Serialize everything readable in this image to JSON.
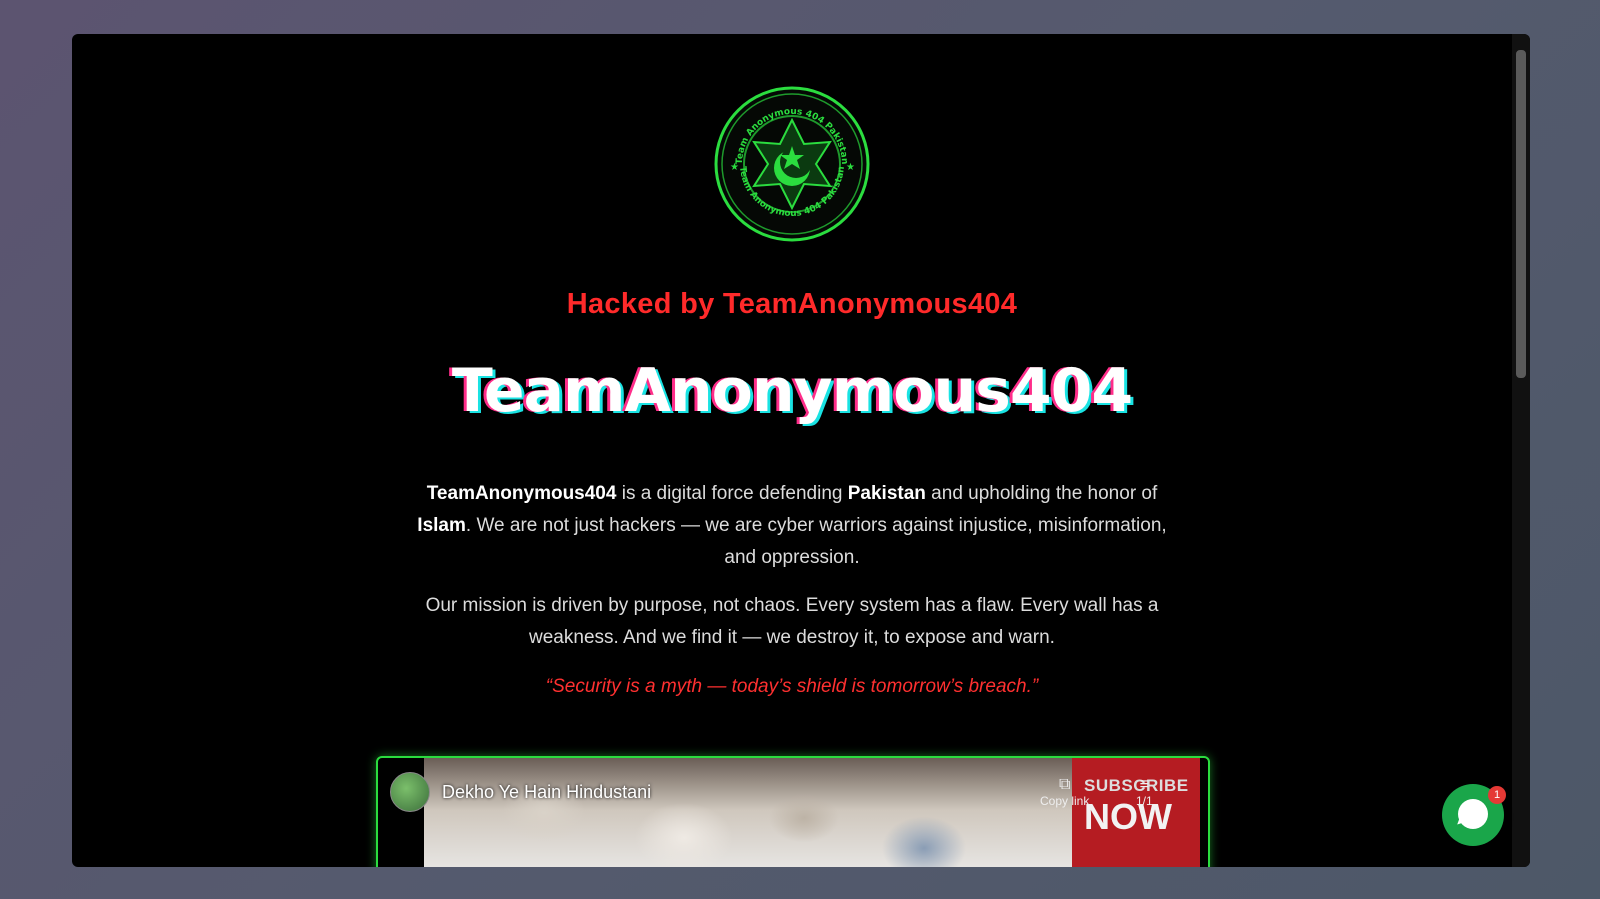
{
  "logo": {
    "ring_text": "Team Anonymous 404 Pakistan",
    "accent_color": "#2bdd3f"
  },
  "hero": {
    "subtitle": "Hacked by TeamAnonymous404",
    "title": "TeamAnonymous404"
  },
  "paragraph1": {
    "part1_bold": "TeamAnonymous404",
    "part2": " is a digital force defending ",
    "part3_bold": "Pakistan",
    "part4": " and upholding the honor of ",
    "part5_bold": "Islam",
    "part6": ". We are not just hackers — we are cyber warriors against injustice, misinformation, and oppression."
  },
  "paragraph2": "Our mission is driven by purpose, not chaos. Every system has a flaw. Every wall has a weakness. And we find it — we destroy it, to expose and warn.",
  "quote": "“Security is a myth — today’s shield is tomorrow’s breach.”",
  "video": {
    "title": "Dekho Ye Hain Hindustani",
    "subscribe_line1": "SUBSCRIBE",
    "subscribe_line2": "NOW",
    "copy_link_label": "Copy link",
    "playlist_count": "1/1"
  },
  "chat": {
    "badge_count": "1"
  },
  "colors": {
    "subtitle": "#ff2a2a",
    "quote": "#ff3030",
    "frame_border": "#2bdd3f",
    "chat_button": "#1aa64a"
  }
}
